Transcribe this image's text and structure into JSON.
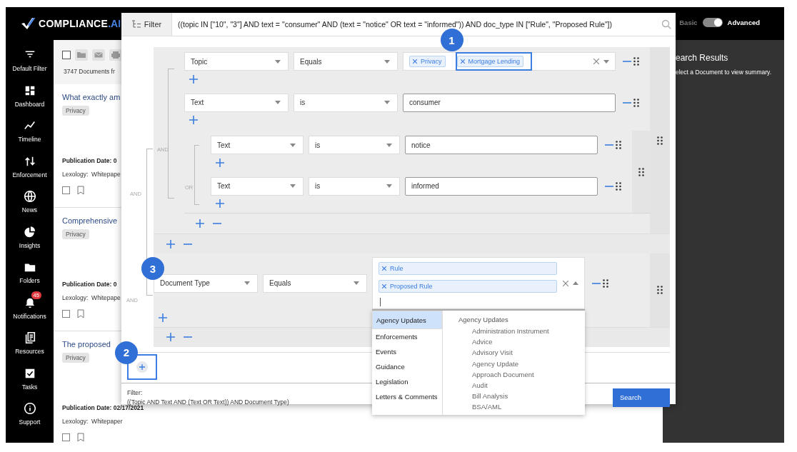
{
  "header": {
    "logo_prefix": "COMPLIANCE",
    "logo_suffix": ".AI",
    "toggle": {
      "left_label": "Basic",
      "right_label": "Advanced",
      "on": true
    }
  },
  "sidebar": {
    "items": [
      {
        "label": "Default Filter"
      },
      {
        "label": "Dashboard"
      },
      {
        "label": "Timeline"
      },
      {
        "label": "Enforcement"
      },
      {
        "label": "News"
      },
      {
        "label": "Insights"
      },
      {
        "label": "Folders"
      },
      {
        "label": "Notifications",
        "badge": "45"
      },
      {
        "label": "Resources"
      },
      {
        "label": "Tasks"
      },
      {
        "label": "Support"
      }
    ]
  },
  "documents": {
    "count": "3747 Documents fr",
    "items": [
      {
        "title": "What exactly am",
        "tag": "Privacy",
        "date": "Publication Date: 0",
        "source": "Lexology:  Whitepape"
      },
      {
        "title": "Comprehensive",
        "tag": "Privacy",
        "date": "Publication Date: 0",
        "source": "Lexology:  Whitepape"
      },
      {
        "title": "The proposed",
        "tag": "Privacy",
        "date": "Publication Date: 02/17/2021",
        "source": "Lexology:  Whitepaper"
      }
    ]
  },
  "search_panel": {
    "title": "earch Results",
    "hint": "elect a Document to view summary."
  },
  "filter_modal": {
    "title": "Filter",
    "query": "((topic IN [\"10\", \"3\"] AND text = \"consumer\" AND (text = \"notice\" OR text = \"informed\")) AND doc_type IN [\"Rule\", \"Proposed Rule\"])",
    "query_builder": {
      "combinator": "AND",
      "children": [
        {
          "kind": "group",
          "children": [
            {
              "kind": "rule",
              "field": "Topic",
              "operator": "Equals",
              "open": false,
              "tags": [
                {
                  "label": "Privacy",
                  "highlighted": false
                },
                {
                  "label": "Mortgage Lending",
                  "highlighted": true,
                  "callout": "1"
                }
              ]
            },
            {
              "kind": "rule",
              "field": "Text",
              "operator": "is",
              "value": "consumer"
            },
            {
              "kind": "group",
              "joiner": "AND",
              "children": [
                {
                  "kind": "rule",
                  "field": "Text",
                  "operator": "is",
                  "value": "notice"
                },
                {
                  "kind": "rule",
                  "field": "Text",
                  "operator": "is",
                  "value": "informed",
                  "joiner": "OR"
                }
              ]
            }
          ]
        },
        {
          "kind": "rule",
          "joiner": "AND",
          "callout": "3",
          "field": "Document Type",
          "operator": "Equals",
          "open": true,
          "tags": [
            {
              "label": "Rule",
              "highlighted": false
            },
            {
              "label": "Proposed Rule",
              "highlighted": false
            }
          ],
          "dropdown": {
            "categories": [
              {
                "label": "Agency Updates",
                "selected": true
              },
              {
                "label": "Enforcements",
                "selected": false
              },
              {
                "label": "Events",
                "selected": false
              },
              {
                "label": "Guidance",
                "selected": false
              },
              {
                "label": "Legislation",
                "selected": false
              },
              {
                "label": "Letters & Comments",
                "selected": false
              }
            ],
            "group_title": "Agency Updates",
            "options": [
              "Administration Instrument",
              "Advice",
              "Advisory Visit",
              "Agency Update",
              "Approach Document",
              "Audit",
              "Bill Analysis",
              "BSA/AML"
            ]
          }
        }
      ]
    },
    "add_group": {
      "callout": "2",
      "highlighted": true
    },
    "summary_label": "Filter:",
    "summary": "((Topic AND Text AND (Text OR Text)) AND Document Type)",
    "search_button": "Search"
  }
}
